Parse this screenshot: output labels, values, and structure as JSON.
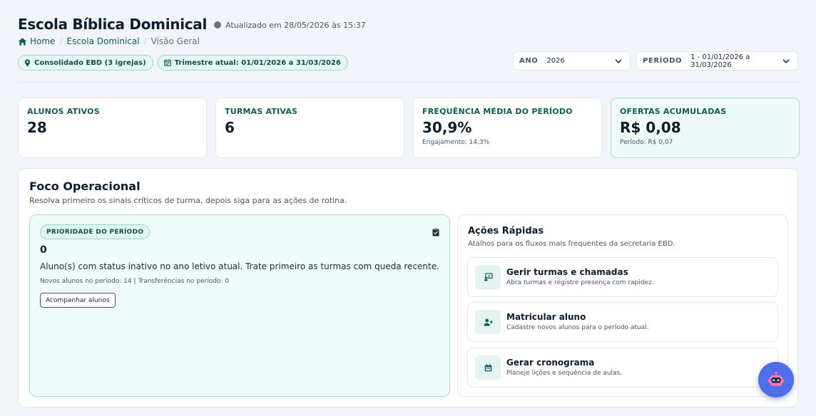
{
  "header": {
    "title": "Escola Bíblica Dominical",
    "updated": "Atualizado em 28/05/2026 às 15:37"
  },
  "breadcrumb": {
    "home": "Home",
    "section": "Escola Dominical",
    "current": "Visão Geral",
    "separator": "/"
  },
  "chips": {
    "scope": "Consolidado EBD (3 igrejas)",
    "quarter": "Trimestre atual: 01/01/2026 a 31/03/2026"
  },
  "filters": {
    "year_label": "ANO",
    "year_value": "2026",
    "period_label": "PERÍODO",
    "period_value": "1 - 01/01/2026 a 31/03/2026"
  },
  "kpis": [
    {
      "label": "ALUNOS ATIVOS",
      "value": "28",
      "sub": ""
    },
    {
      "label": "TURMAS ATIVAS",
      "value": "6",
      "sub": ""
    },
    {
      "label": "FREQUÊNCIA MÉDIA DO PERÍODO",
      "value": "30,9%",
      "sub": "Engajamento: 14,3%"
    },
    {
      "label": "OFERTAS ACUMULADAS",
      "value": "R$ 0,08",
      "sub": "Período: R$ 0,07"
    }
  ],
  "focus": {
    "title": "Foco Operacional",
    "subtitle": "Resolva primeiro os sinais críticos de turma, depois siga para as ações de rotina.",
    "priority": {
      "chip": "PRIORIDADE DO PERÍODO",
      "value": "0",
      "text": "Aluno(s) com status inativo no ano letivo atual. Trate primeiro as turmas com queda recente.",
      "meta": "Novos alunos no período: 14 | Transferências no período: 0",
      "button": "Acompanhar alunos"
    },
    "quick_actions": {
      "title": "Ações Rápidas",
      "subtitle": "Atalhos para os fluxos mais frequentes da secretaria EBD.",
      "items": [
        {
          "title": "Gerir turmas e chamadas",
          "sub": "Abra turmas e registre presença com rapidez.",
          "icon": "classroom-icon"
        },
        {
          "title": "Matricular aluno",
          "sub": "Cadastre novos alunos para o período atual.",
          "icon": "user-plus-icon"
        },
        {
          "title": "Gerar cronograma",
          "sub": "Planeje lições e sequência de aulas.",
          "icon": "calendar-icon"
        }
      ]
    }
  },
  "colors": {
    "accent": "#0f5c56",
    "chip_bg": "#e6f6f3",
    "fab": "#4f6fe8"
  }
}
